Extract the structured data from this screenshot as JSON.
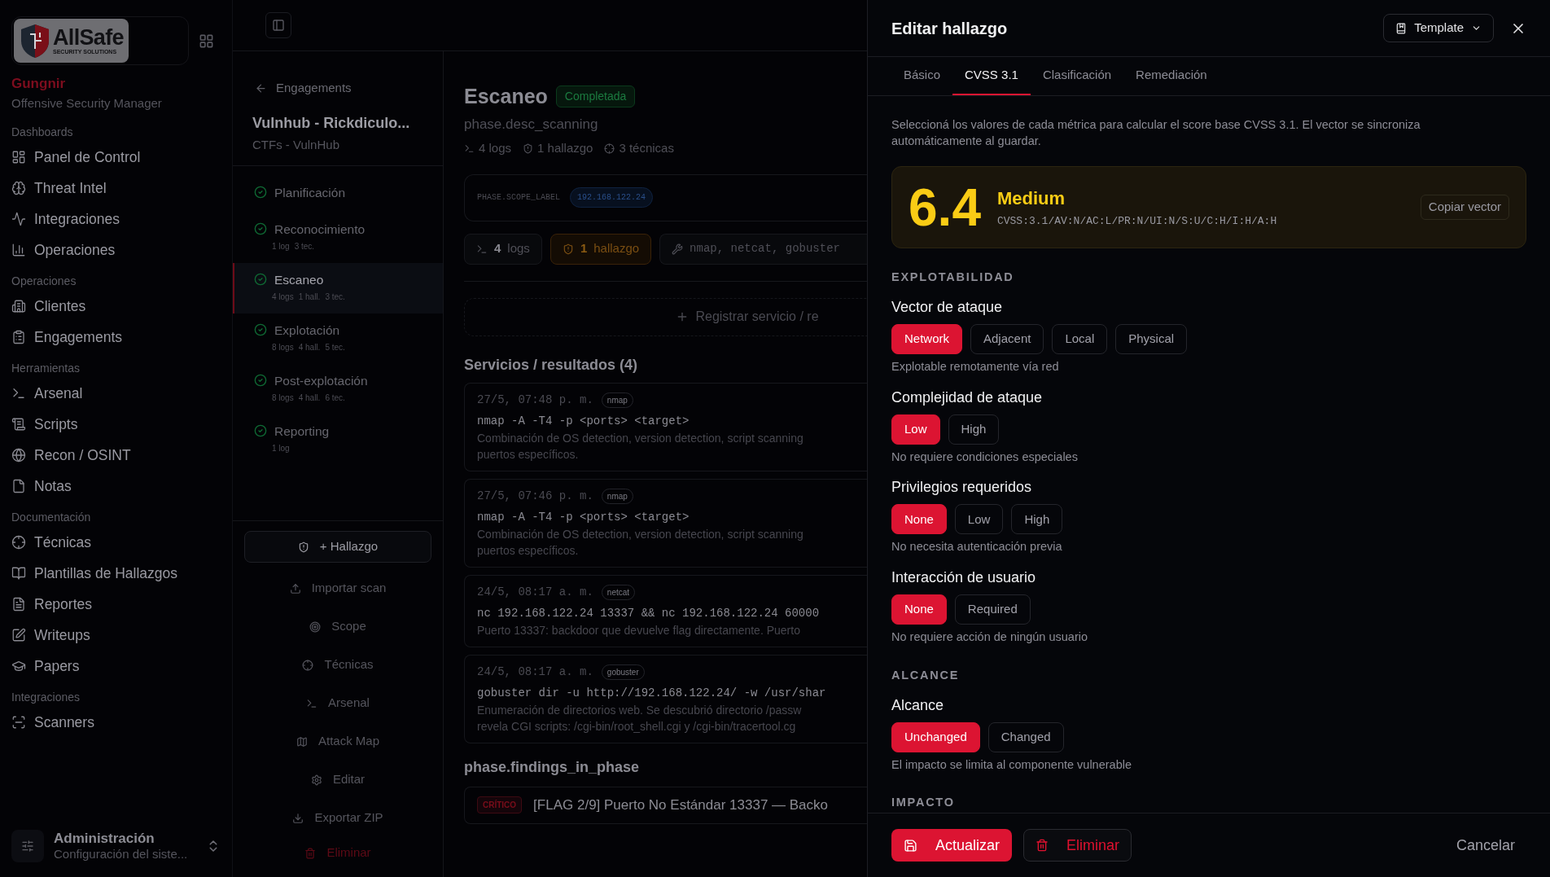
{
  "sidebar": {
    "logo": {
      "name": "AllSafe",
      "tagline": "SECURITY SOLUTIONS"
    },
    "app_name": "Gungnir",
    "app_subtitle": "Offensive Security Manager",
    "sections": [
      {
        "title": "Dashboards",
        "items": [
          "Panel de Control",
          "Threat Intel",
          "Integraciones",
          "Operaciones"
        ]
      },
      {
        "title": "Operaciones",
        "items": [
          "Clientes",
          "Engagements"
        ]
      },
      {
        "title": "Herramientas",
        "items": [
          "Arsenal",
          "Scripts",
          "Recon / OSINT",
          "Notas"
        ]
      },
      {
        "title": "Documentación",
        "items": [
          "Técnicas",
          "Plantillas de Hallazgos",
          "Reportes",
          "Writeups",
          "Papers"
        ]
      },
      {
        "title": "Integraciones",
        "items": [
          "Scanners"
        ]
      }
    ],
    "footer": {
      "title": "Administración",
      "subtitle": "Configuración del siste..."
    }
  },
  "engagement_panel": {
    "back": "Engagements",
    "title": "Vulnhub - Rickdiculo...",
    "subtitle": "CTFs - VulnHub",
    "phases": [
      {
        "name": "Planificación",
        "selected": false
      },
      {
        "name": "Reconocimiento",
        "stats": [
          "1 log",
          "3 tec."
        ],
        "selected": false
      },
      {
        "name": "Escaneo",
        "stats": [
          "4 logs",
          "1 hall.",
          "3 tec."
        ],
        "selected": true
      },
      {
        "name": "Explotación",
        "stats": [
          "8 logs",
          "4 hall.",
          "5 tec."
        ],
        "selected": false
      },
      {
        "name": "Post-explotación",
        "stats": [
          "8 logs",
          "4 hall.",
          "6 tec."
        ],
        "selected": false
      },
      {
        "name": "Reporting",
        "stats": [
          "1 log"
        ],
        "selected": false
      }
    ],
    "actions": [
      {
        "label": "+ Hallazgo",
        "kind": "primary"
      },
      {
        "label": "Importar scan",
        "kind": "plain"
      },
      {
        "label": "Scope",
        "kind": "plain"
      },
      {
        "label": "Técnicas",
        "kind": "plain"
      },
      {
        "label": "Arsenal",
        "kind": "plain"
      },
      {
        "label": "Attack Map",
        "kind": "plain"
      },
      {
        "label": "Editar",
        "kind": "plain"
      },
      {
        "label": "Exportar ZIP",
        "kind": "plain"
      },
      {
        "label": "Eliminar",
        "kind": "danger"
      }
    ]
  },
  "phase": {
    "title": "Escaneo",
    "status": "Completada",
    "description": "phase.desc_scanning",
    "meta": [
      "4 logs",
      "1 hallazgo",
      "3 técnicas"
    ],
    "scope": {
      "label": "PHASE.SCOPE_LABEL",
      "target": "192.168.122.24"
    },
    "chips": [
      {
        "count": "4",
        "label": "logs"
      },
      {
        "count": "1",
        "label": "hallazgo"
      }
    ],
    "tools": "nmap, netcat, gobuster",
    "register_button": "Registrar servicio / re",
    "services_heading": "Servicios / resultados (4)",
    "services": [
      {
        "time": "27/5, 07:48 p. m.",
        "tool": "nmap",
        "command": "nmap -A -T4 -p <ports> <target>",
        "description": [
          "Combinación de OS detection, version detection, script scanning",
          "puertos específicos."
        ]
      },
      {
        "time": "27/5, 07:46 p. m.",
        "tool": "nmap",
        "command": "nmap -A -T4 -p <ports> <target>",
        "description": [
          "Combinación de OS detection, version detection, script scanning",
          "puertos específicos."
        ]
      },
      {
        "time": "24/5, 08:17 a. m.",
        "tool": "netcat",
        "command": "nc 192.168.122.24 13337 && nc 192.168.122.24 60000",
        "description": [
          "Puerto 13337: backdoor que devuelve flag directamente. Puerto"
        ]
      },
      {
        "time": "24/5, 08:17 a. m.",
        "tool": "gobuster",
        "command": "gobuster dir -u http://192.168.122.24/ -w /usr/shar",
        "description": [
          "Enumeración de directorios web. Se descubrió directorio /passw",
          "revela CGI scripts: /cgi-bin/root_shell.cgi y /cgi-bin/tracertool.cg"
        ]
      }
    ],
    "findings_heading": "phase.findings_in_phase",
    "findings": [
      {
        "severity": "CRÍTICO",
        "title": "[FLAG 2/9] Puerto No Estándar 13337 — Backo"
      }
    ]
  },
  "drawer": {
    "title": "Editar hallazgo",
    "template_button": "Template",
    "tabs": [
      {
        "label": "Básico",
        "selected": false
      },
      {
        "label": "CVSS 3.1",
        "selected": true
      },
      {
        "label": "Clasificación",
        "selected": false
      },
      {
        "label": "Remediación",
        "selected": false
      }
    ],
    "intro": "Seleccioná los valores de cada métrica para calcular el score base CVSS 3.1. El vector se sincroniza automáticamente al guardar.",
    "score": {
      "value": "6.4",
      "severity": "Medium",
      "vector": "CVSS:3.1/AV:N/AC:L/PR:N/UI:N/S:U/C:H/I:H/A:H",
      "copy_button": "Copiar vector"
    },
    "groups": [
      {
        "title": "EXPLOTABILIDAD",
        "metrics": [
          {
            "label": "Vector de ataque",
            "options": [
              {
                "label": "Network",
                "selected": true
              },
              {
                "label": "Adjacent",
                "selected": false
              },
              {
                "label": "Local",
                "selected": false
              },
              {
                "label": "Physical",
                "selected": false
              }
            ],
            "hint": "Explotable remotamente vía red"
          },
          {
            "label": "Complejidad de ataque",
            "options": [
              {
                "label": "Low",
                "selected": true
              },
              {
                "label": "High",
                "selected": false
              }
            ],
            "hint": "No requiere condiciones especiales"
          },
          {
            "label": "Privilegios requeridos",
            "options": [
              {
                "label": "None",
                "selected": true
              },
              {
                "label": "Low",
                "selected": false
              },
              {
                "label": "High",
                "selected": false
              }
            ],
            "hint": "No necesita autenticación previa"
          },
          {
            "label": "Interacción de usuario",
            "options": [
              {
                "label": "None",
                "selected": true
              },
              {
                "label": "Required",
                "selected": false
              }
            ],
            "hint": "No requiere acción de ningún usuario"
          }
        ]
      },
      {
        "title": "ALCANCE",
        "metrics": [
          {
            "label": "Alcance",
            "options": [
              {
                "label": "Unchanged",
                "selected": true
              },
              {
                "label": "Changed",
                "selected": false
              }
            ],
            "hint": "El impacto se limita al componente vulnerable"
          }
        ]
      },
      {
        "title": "IMPACTO"
      }
    ],
    "footer": {
      "save": "Actualizar",
      "delete": "Eliminar",
      "cancel": "Cancelar"
    }
  }
}
